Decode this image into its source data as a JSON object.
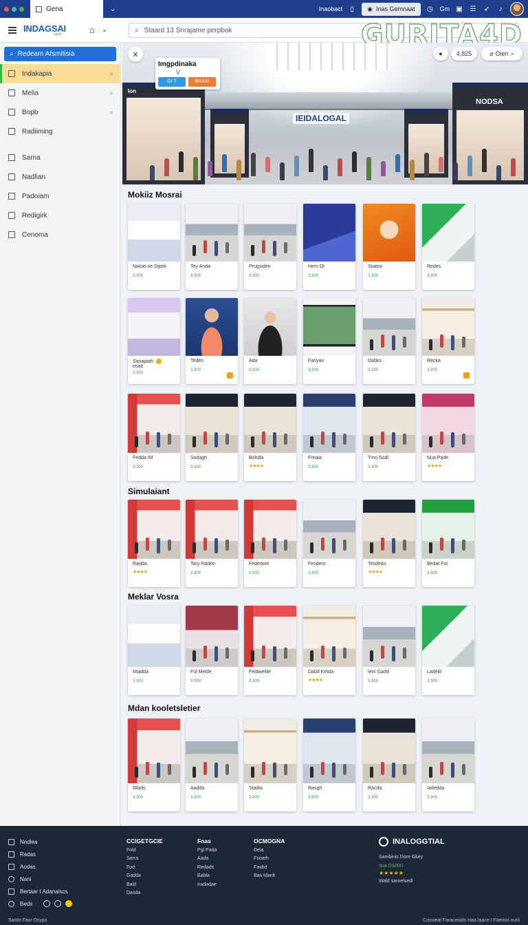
{
  "window": {
    "tab_title": "Gena",
    "right_text": "Inaobact",
    "right_button": "Inas Gemnaat",
    "right_label": "Gm"
  },
  "header": {
    "logo_main": "INDAGSAI",
    "logo_sub": "ngsis",
    "search_placeholder": "Staard 13 Snrajame perpbok",
    "watermark": "GURITA4D"
  },
  "sidebar": {
    "search_label": "Redeam Afsmitisia",
    "items": [
      {
        "label": "Indakapia",
        "icon": "folder-icon",
        "active": true
      },
      {
        "label": "Melia",
        "icon": "calendar-icon",
        "active": false
      },
      {
        "label": "Bopb",
        "icon": "box-icon",
        "active": false
      },
      {
        "label": "Radiiming",
        "icon": "bookmark-icon",
        "active": false
      },
      {
        "label": "Sarna",
        "icon": "grid-icon",
        "active": false
      },
      {
        "label": "Nadlian",
        "icon": "thumb-icon",
        "active": false
      },
      {
        "label": "Padoiam",
        "icon": "doc-icon",
        "active": false
      },
      {
        "label": "Redigirk",
        "icon": "list-icon",
        "active": false
      },
      {
        "label": "Cenoma",
        "icon": "search-icon",
        "active": false
      }
    ]
  },
  "hero": {
    "card_title": "Imgpdinaka",
    "card_mark": "V",
    "btn_left": "GI T",
    "btn_right": "BRASI",
    "chip_count": "4,825",
    "chip_label": "Oien",
    "store_left": "Ion",
    "store_right": "NODSA",
    "center_sign": "IEIDALOGAL"
  },
  "sections": [
    {
      "title": "Mokiiz Mosrai",
      "rows": [
        [
          {
            "name": "Nokas se Dipek",
            "price": "3.300",
            "scene": "kiosk-blue"
          },
          {
            "name": "Tey Anda",
            "price": "3.300",
            "scene": "mall-hall"
          },
          {
            "name": "Prugsiden",
            "price": "3.300",
            "scene": "mall-hall"
          },
          {
            "name": "Hem Ot",
            "price": "3.300",
            "scene": "poster-blue"
          },
          {
            "name": "Suatra",
            "price": "3.300",
            "scene": "poster-orange"
          },
          {
            "name": "Redes",
            "price": "3.300",
            "scene": "kiosk-green"
          }
        ],
        [
          {
            "name": "Sanaptah",
            "sub": "eoab",
            "price": "3.300",
            "scene": "kiosk-purple",
            "dot": true
          },
          {
            "name": "Teden",
            "price": "3.300",
            "scene": "person-blue",
            "badge": true
          },
          {
            "name": "Ada",
            "price": "3.300",
            "scene": "person-dark"
          },
          {
            "name": "Fariyan",
            "price": "3.300",
            "scene": "tablet"
          },
          {
            "name": "Dabks",
            "price": "3.300",
            "scene": "mall-hall"
          },
          {
            "name": "Recka",
            "price": "3.300",
            "scene": "store-beige",
            "badge": true
          }
        ],
        [
          {
            "name": "Fedda IM",
            "price": "3.300",
            "scene": "store-red"
          },
          {
            "name": "Sodagh",
            "price": "3.300",
            "scene": "store-dark"
          },
          {
            "name": "Bolsda",
            "price": "★★★★",
            "scene": "store-dark",
            "stars": true
          },
          {
            "name": "Freaia",
            "price": "3.300",
            "scene": "store-blue"
          },
          {
            "name": "Tmo Sodl",
            "price": "3.300",
            "scene": "store-dark"
          },
          {
            "name": "Nua Pade",
            "price": "★★★★",
            "scene": "store-pink",
            "stars": true
          }
        ]
      ]
    },
    {
      "title": "Simulaiant",
      "rows": [
        [
          {
            "name": "Radda",
            "price": "★★★★",
            "scene": "store-red",
            "stars": true
          },
          {
            "name": "Tary Radeo",
            "price": "3.300",
            "scene": "store-red"
          },
          {
            "name": "Fededom",
            "price": "3.300",
            "scene": "store-red"
          },
          {
            "name": "Fesdent",
            "price": "3.300",
            "scene": "mall-hall"
          },
          {
            "name": "Tesdedo",
            "price": "★★★★",
            "scene": "store-dark",
            "stars": true
          },
          {
            "name": "Bedat Fol",
            "price": "3.300",
            "scene": "store-green"
          }
        ]
      ]
    },
    {
      "title": "Meklar Vosra",
      "rows": [
        [
          {
            "name": "Miadda",
            "price": "3.300",
            "scene": "kiosk-blue"
          },
          {
            "name": "Ful Melde",
            "price": "3.300",
            "scene": "mall-street"
          },
          {
            "name": "Feldwelde",
            "price": "3.300",
            "scene": "store-red"
          },
          {
            "name": "Dabd Ketda",
            "price": "★★★★",
            "scene": "store-beige",
            "stars": true
          },
          {
            "name": "Iem Gadd",
            "price": "3.300",
            "scene": "mall-hall"
          },
          {
            "name": "Ladeld",
            "price": "3.300",
            "scene": "kiosk-green"
          }
        ]
      ]
    },
    {
      "title": "Mdan kooletsletier",
      "rows": [
        [
          {
            "name": "Mlads",
            "price": "3.300",
            "scene": "store-red"
          },
          {
            "name": "Aadda",
            "price": "3.300",
            "scene": "mall-hall"
          },
          {
            "name": "Stadia",
            "price": "3.300",
            "scene": "store-beige"
          },
          {
            "name": "Rasgh",
            "price": "3.300",
            "scene": "store-blue"
          },
          {
            "name": "Racda",
            "price": "3.300",
            "scene": "store-dark"
          },
          {
            "name": "Iadedda",
            "price": "3.300",
            "scene": "mall-hall"
          }
        ]
      ]
    }
  ],
  "footer": {
    "links": [
      {
        "label": "Nedlea",
        "icon": "grid-icon"
      },
      {
        "label": "Radas",
        "icon": "list-icon"
      },
      {
        "label": "Aodas",
        "icon": "gear-icon"
      },
      {
        "label": "Nani",
        "icon": "circle-icon"
      },
      {
        "label": "Bertaar I Adanaiscs",
        "icon": "doc-icon"
      },
      {
        "label": "Beds",
        "icon": "circle-icon"
      }
    ],
    "col1": {
      "title": "CCIGETGCIE",
      "items": [
        "Fold",
        "Sarra",
        "Fod",
        "Gadda",
        "Bald",
        "Dasda"
      ]
    },
    "col2": {
      "title": "Fnas",
      "items": [
        "Pgl Pada",
        "Aada",
        "Redads",
        "Babla",
        "Iradadae"
      ]
    },
    "col3": {
      "title": "OCMOGNA",
      "items": [
        "Dela",
        "Fsoarh",
        "Fasbd",
        "Bas Idanh"
      ]
    },
    "brand": {
      "title": "INALOGGTIAL",
      "subtitle": "Sambinis Dore Gkey",
      "price": "Itua DS800",
      "rating": "★★★★★",
      "note": "Wald saroelsedl"
    },
    "bottom_left": "Sardo Fasr Dcypo",
    "bottom_right": "Cossieal Faracesids Haa laace I Faeoos ourii"
  }
}
